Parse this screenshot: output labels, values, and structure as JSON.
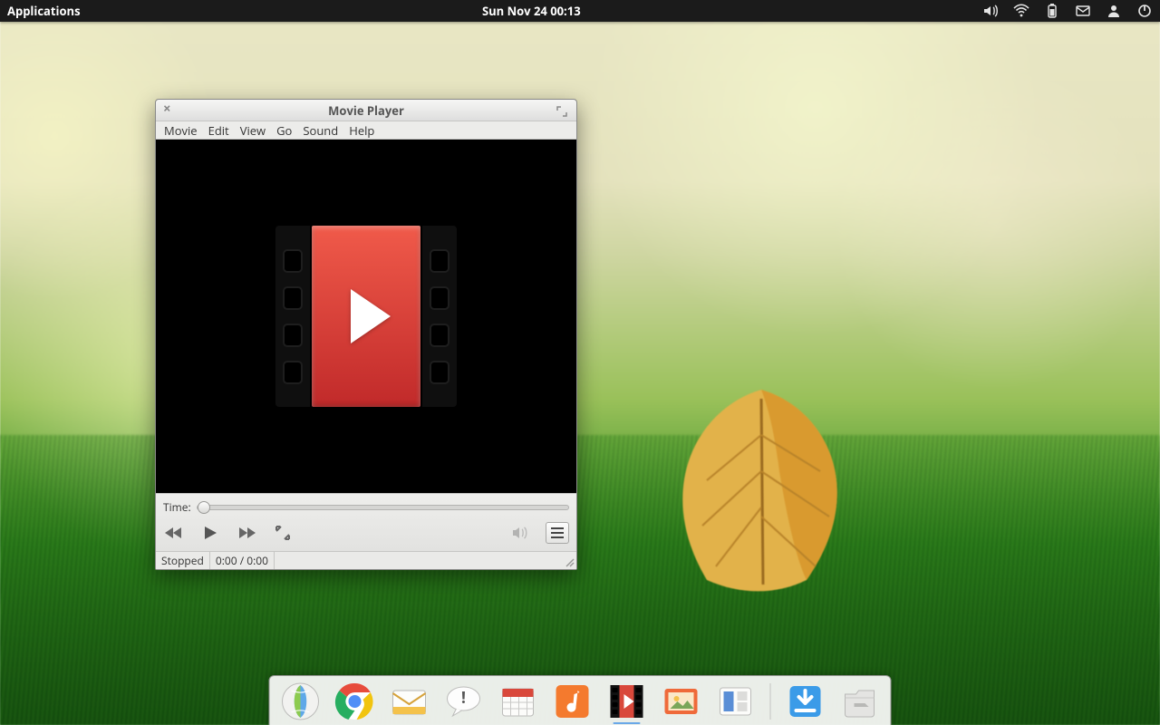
{
  "panel": {
    "applications_label": "Applications",
    "clock": "Sun Nov 24 00:13",
    "indicators": {
      "sound": "sound-icon",
      "network": "network-wireless-icon",
      "battery": "battery-icon",
      "mail": "mail-icon",
      "user": "user-icon",
      "power": "power-icon"
    }
  },
  "window": {
    "title": "Movie Player",
    "menus": [
      "Movie",
      "Edit",
      "View",
      "Go",
      "Sound",
      "Help"
    ],
    "time_label": "Time:",
    "status": "Stopped",
    "time_display": "0:00 / 0:00"
  },
  "dock": {
    "items": [
      {
        "name": "web-browser-icon",
        "label": "Web Browser"
      },
      {
        "name": "chrome-icon",
        "label": "Google Chrome"
      },
      {
        "name": "mail-app-icon",
        "label": "Mail"
      },
      {
        "name": "chat-icon",
        "label": "Empathy"
      },
      {
        "name": "calendar-icon",
        "label": "Calendar"
      },
      {
        "name": "music-icon",
        "label": "Music"
      },
      {
        "name": "movie-player-icon",
        "label": "Movie Player",
        "active": true
      },
      {
        "name": "photos-icon",
        "label": "Photos"
      },
      {
        "name": "workspaces-icon",
        "label": "Workspaces"
      },
      {
        "name": "downloads-icon",
        "label": "Downloads"
      },
      {
        "name": "files-icon",
        "label": "Files"
      }
    ]
  }
}
